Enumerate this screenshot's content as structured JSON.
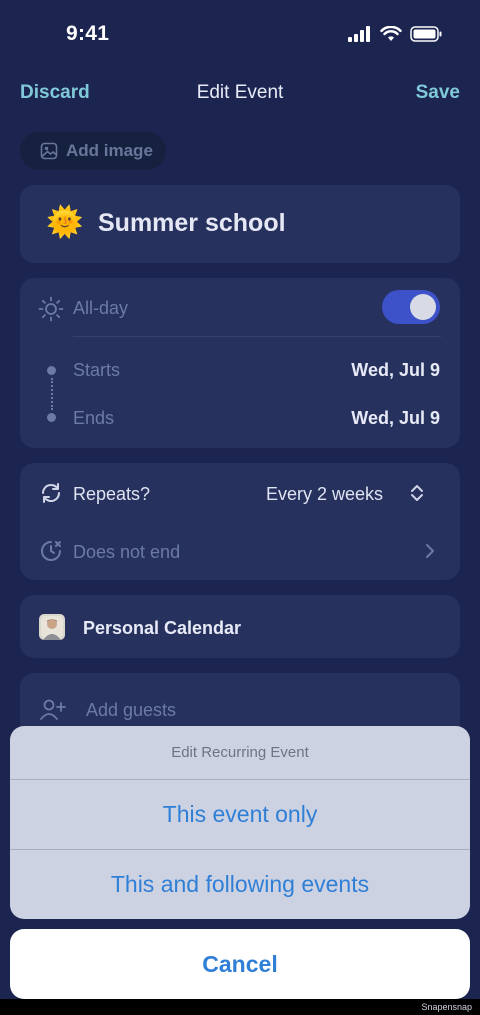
{
  "status_bar": {
    "time": "9:41"
  },
  "nav": {
    "discard": "Discard",
    "title": "Edit Event",
    "save": "Save"
  },
  "add_image": {
    "label": "Add image",
    "icon": "image-icon"
  },
  "event": {
    "title": "Summer school",
    "emoji": "🌞"
  },
  "allday": {
    "label": "All-day",
    "on": true,
    "icon": "sun-icon"
  },
  "starts": {
    "label": "Starts",
    "value": "Wed, Jul 9"
  },
  "ends": {
    "label": "Ends",
    "value": "Wed, Jul 9"
  },
  "repeats": {
    "label": "Repeats?",
    "value": "Every 2 weeks",
    "icon": "repeat-icon"
  },
  "end_rule": {
    "label": "Does not end",
    "icon": "timer-icon"
  },
  "calendar": {
    "label": "Personal Calendar"
  },
  "guests": {
    "label": "Add guests",
    "icon": "add-person-icon"
  },
  "sheet": {
    "title": "Edit Recurring Event",
    "option1": "This event only",
    "option2": "This and following events",
    "cancel": "Cancel"
  },
  "watermark": "Snapensnap",
  "colors": {
    "background": "#1b2550",
    "card": "#26315e",
    "accent": "#7fc9d8",
    "toggle": "#3d52c9",
    "action": "#2f7fd6"
  }
}
